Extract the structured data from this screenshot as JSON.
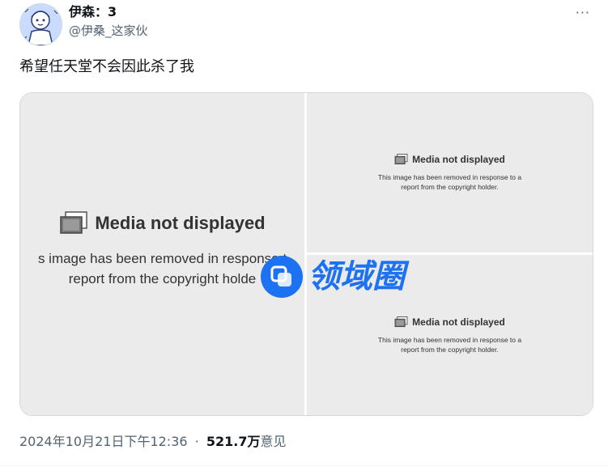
{
  "author": {
    "display_name": "伊森：3",
    "handle": "@伊桑_这家伙"
  },
  "tweet": {
    "text": "希望任天堂不会因此杀了我"
  },
  "media": [
    {
      "title": "Media not displayed",
      "description_line1": "s image has been removed in response t",
      "description_line2": "report from the copyright holde"
    },
    {
      "title": "Media not displayed",
      "description_line1": "This image has been removed in response to a",
      "description_line2": "report from the copyright holder."
    },
    {
      "title": "Media not displayed",
      "description_line1": "This image has been removed in response to a",
      "description_line2": "report from the copyright holder."
    }
  ],
  "watermark": {
    "text": "领域圈"
  },
  "footer": {
    "timestamp": "2024年10月21日下午12:36",
    "separator": "·",
    "views_count": "521.7万",
    "views_label": "意见"
  },
  "more_button": "···",
  "colors": {
    "text_primary": "#0f1419",
    "text_secondary": "#536471",
    "media_bg": "#ebebeb",
    "watermark_blue": "#1d72f2"
  }
}
